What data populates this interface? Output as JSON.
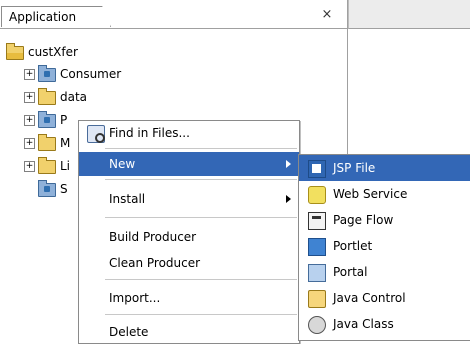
{
  "app": {
    "tab_label": "Application",
    "close_glyph": "×"
  },
  "tree": {
    "root_label": "custXfer",
    "items": [
      {
        "label": "Consumer",
        "expander": "+",
        "icon": "blue-folder-icon"
      },
      {
        "label": "data",
        "expander": "+",
        "icon": "folder-icon"
      },
      {
        "label": "P",
        "expander": "+",
        "icon": "blue-folder-icon"
      },
      {
        "label": "M",
        "expander": "+",
        "icon": "folder-icon"
      },
      {
        "label": "Li",
        "expander": "+",
        "icon": "folder-icon"
      },
      {
        "label": "S",
        "expander": "",
        "icon": "blue-folder-icon"
      }
    ]
  },
  "context_menu": {
    "items": [
      {
        "label": "Find in Files...",
        "icon": "find-icon",
        "submenu": false,
        "highlight": false
      },
      {
        "label": "New",
        "icon": "",
        "submenu": true,
        "highlight": true
      },
      {
        "label": "Install",
        "icon": "",
        "submenu": true,
        "highlight": false
      },
      {
        "label": "Build Producer",
        "icon": "",
        "submenu": false,
        "highlight": false
      },
      {
        "label": "Clean Producer",
        "icon": "",
        "submenu": false,
        "highlight": false
      },
      {
        "label": "Import...",
        "icon": "",
        "submenu": false,
        "highlight": false
      },
      {
        "label": "Delete",
        "icon": "",
        "submenu": false,
        "highlight": false
      }
    ]
  },
  "submenu": {
    "items": [
      {
        "label": "JSP File",
        "icon": "jsp-file-icon",
        "highlight": true
      },
      {
        "label": "Web Service",
        "icon": "web-service-icon",
        "highlight": false
      },
      {
        "label": "Page Flow",
        "icon": "page-flow-icon",
        "highlight": false
      },
      {
        "label": "Portlet",
        "icon": "portlet-icon",
        "highlight": false
      },
      {
        "label": "Portal",
        "icon": "portal-icon",
        "highlight": false
      },
      {
        "label": "Java Control",
        "icon": "java-control-icon",
        "highlight": false
      },
      {
        "label": "Java Class",
        "icon": "java-class-icon",
        "highlight": false
      }
    ]
  },
  "colors": {
    "highlight": "#3367b6",
    "panel_border": "#a0a0a0"
  }
}
